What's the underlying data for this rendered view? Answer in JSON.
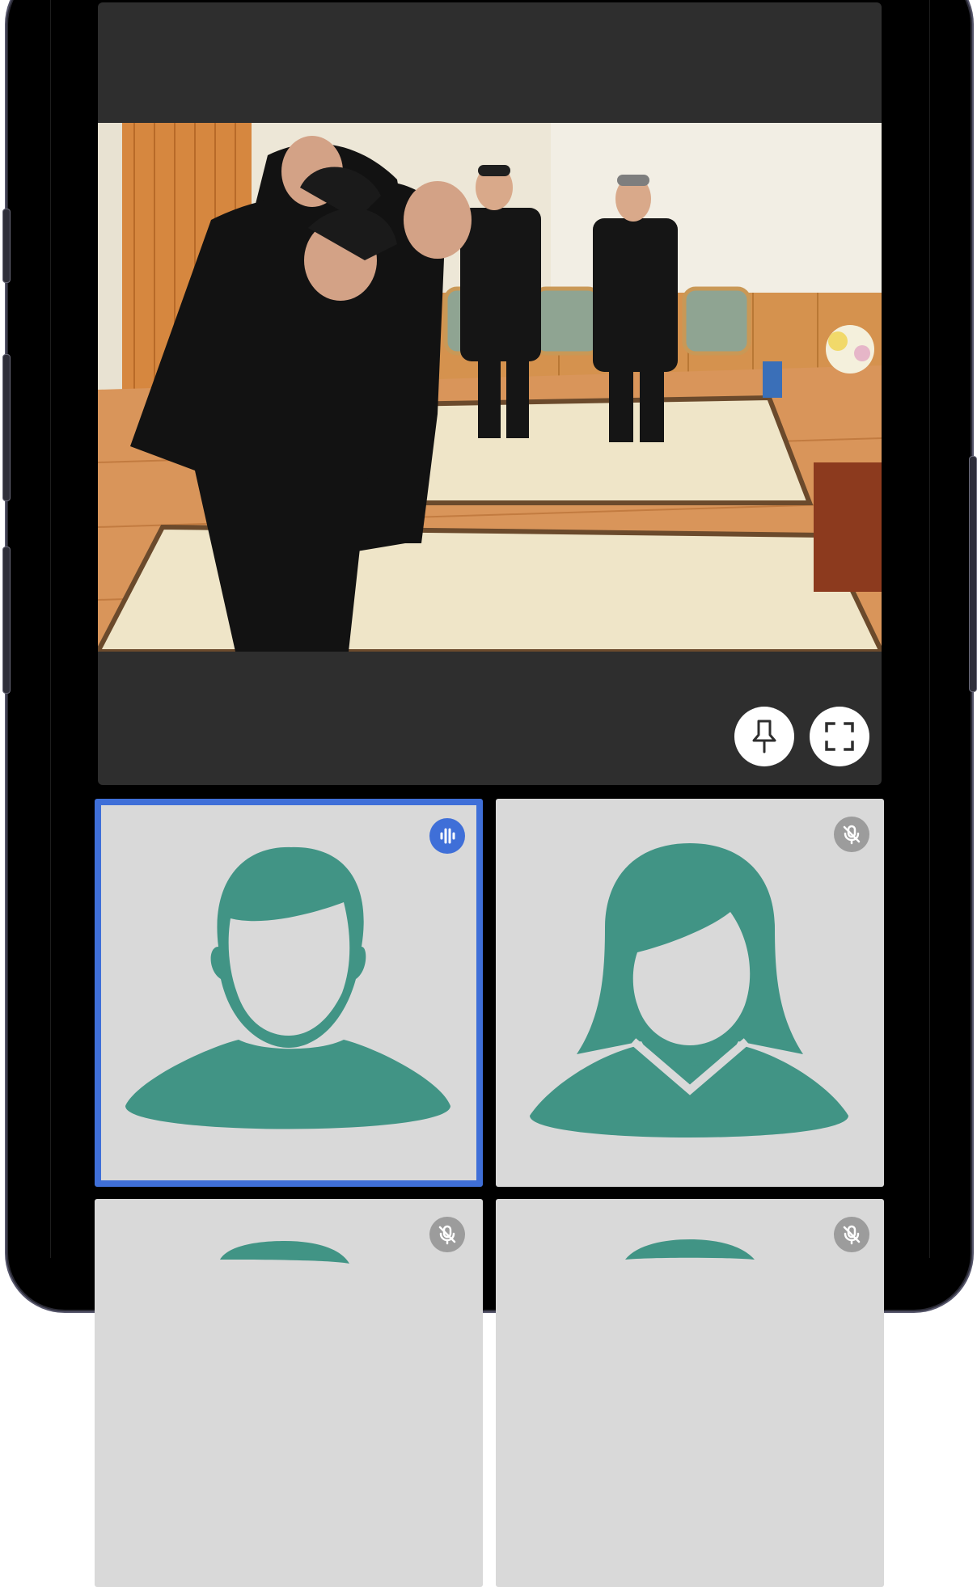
{
  "colors": {
    "stage_background": "#2e2e2e",
    "tile_background": "#d9d9d9",
    "avatar": "#419485",
    "active_speaker_border": "#3f6fd8",
    "muted_badge": "#9c9c9c"
  },
  "main_video": {
    "content": "photo",
    "controls": [
      {
        "icon": "pin-icon"
      },
      {
        "icon": "fullscreen-icon"
      }
    ]
  },
  "participants": [
    {
      "avatar": "male-avatar-icon",
      "status": "speaking",
      "status_icon": "audio-level-icon",
      "active_speaker": true
    },
    {
      "avatar": "female-avatar-icon",
      "status": "muted",
      "status_icon": "mic-off-icon",
      "active_speaker": false
    },
    {
      "avatar": "male-avatar-icon",
      "status": "muted",
      "status_icon": "mic-off-icon",
      "active_speaker": false
    },
    {
      "avatar": "female-avatar-icon",
      "status": "muted",
      "status_icon": "mic-off-icon",
      "active_speaker": false
    }
  ]
}
